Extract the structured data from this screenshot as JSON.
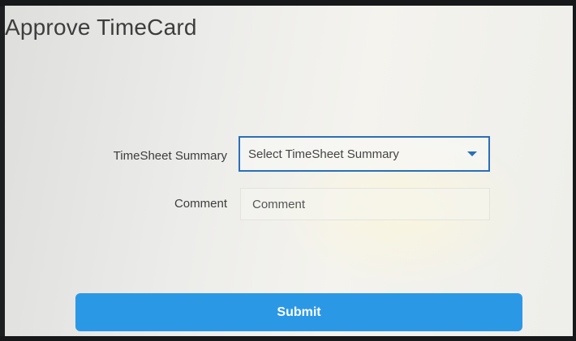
{
  "page": {
    "title": "Approve TimeCard"
  },
  "form": {
    "timesheet_summary": {
      "label": "TimeSheet Summary",
      "selected_value": "Select TimeSheet Summary",
      "icon": "caret-down-icon"
    },
    "comment": {
      "label": "Comment",
      "placeholder": "Comment",
      "value": ""
    },
    "submit_label": "Submit"
  },
  "colors": {
    "accent": "#2b98e6",
    "focus_border": "#2a6fb8",
    "text": "#3c3c3c"
  }
}
